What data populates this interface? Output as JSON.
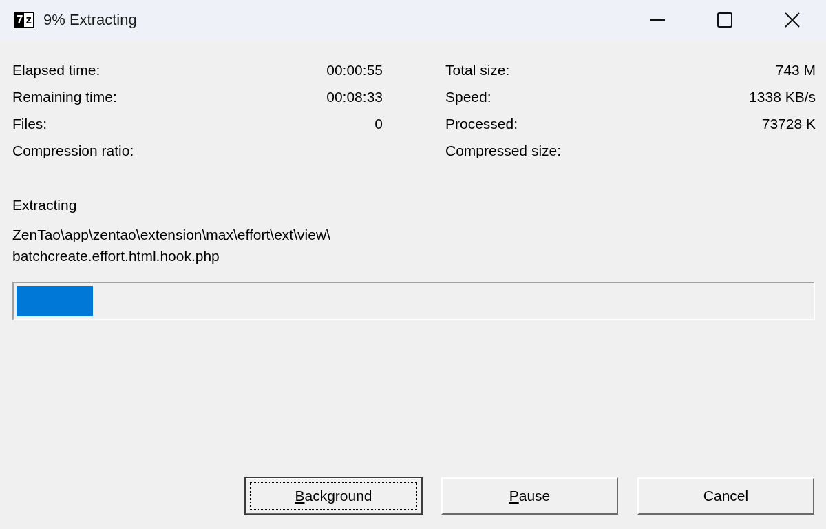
{
  "window": {
    "icon_text": "7z",
    "title": "9% Extracting",
    "controls": [
      {
        "kind": "minimize"
      },
      {
        "kind": "maximize"
      },
      {
        "kind": "close"
      }
    ]
  },
  "stats_left": [
    {
      "label": "Elapsed time:",
      "value": "00:00:55"
    },
    {
      "label": "Remaining time:",
      "value": "00:08:33"
    },
    {
      "label": "Files:",
      "value": "0"
    },
    {
      "label": "Compression ratio:"
    }
  ],
  "stats_right": [
    {
      "label": "Total size:",
      "value": "743 M"
    },
    {
      "label": "Speed:",
      "value": "1338 KB/s"
    },
    {
      "label": "Processed:",
      "value": "73728 K"
    },
    {
      "label": "Compressed size:"
    }
  ],
  "operation": "Extracting",
  "current_file_lines": [
    "ZenTao\\app\\zentao\\extension\\max\\effort\\ext\\view\\",
    "batchcreate.effort.html.hook.php"
  ],
  "progress": {
    "level": 0.096
  },
  "buttons": [
    {
      "label": "Background",
      "focused": true,
      "access_key": true
    },
    {
      "label": "Pause",
      "focused": false,
      "access_key": true
    },
    {
      "label": "Cancel",
      "focused": false,
      "access_key": false
    }
  ]
}
